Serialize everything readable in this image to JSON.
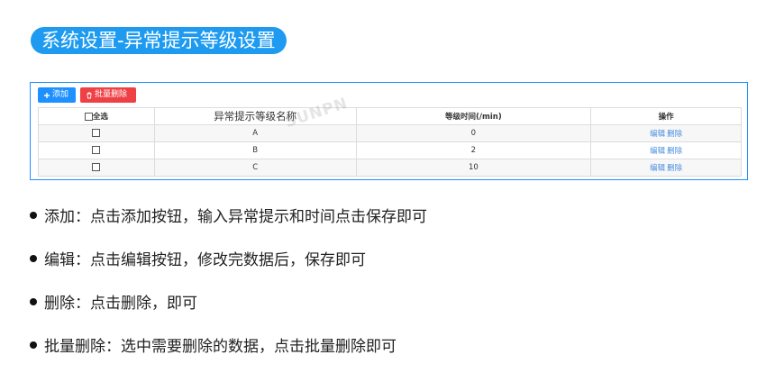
{
  "title": "系统设置-异常提示等级设置",
  "toolbar": {
    "add_label": "添加",
    "batch_delete_label": "批量删除"
  },
  "table": {
    "headers": {
      "select_all": "全选",
      "name": "异常提示等级名称",
      "time": "等级时间(/min)",
      "actions": "操作"
    },
    "rows": [
      {
        "name": "A",
        "time": "0",
        "edit": "编辑",
        "delete": "删除"
      },
      {
        "name": "B",
        "time": "2",
        "edit": "编辑",
        "delete": "删除"
      },
      {
        "name": "C",
        "time": "10",
        "edit": "编辑",
        "delete": "删除"
      }
    ]
  },
  "watermark": "SUNPN",
  "bullets": [
    "添加：点击添加按钮，输入异常提示和时间点击保存即可",
    "编辑：点击编辑按钮，修改完数据后，保存即可",
    "删除：点击删除，即可",
    "批量删除：选中需要删除的数据，点击批量删除即可"
  ],
  "colors": {
    "accent": "#1e9bf0",
    "danger": "#ef4045",
    "link": "#4a8ee0"
  }
}
